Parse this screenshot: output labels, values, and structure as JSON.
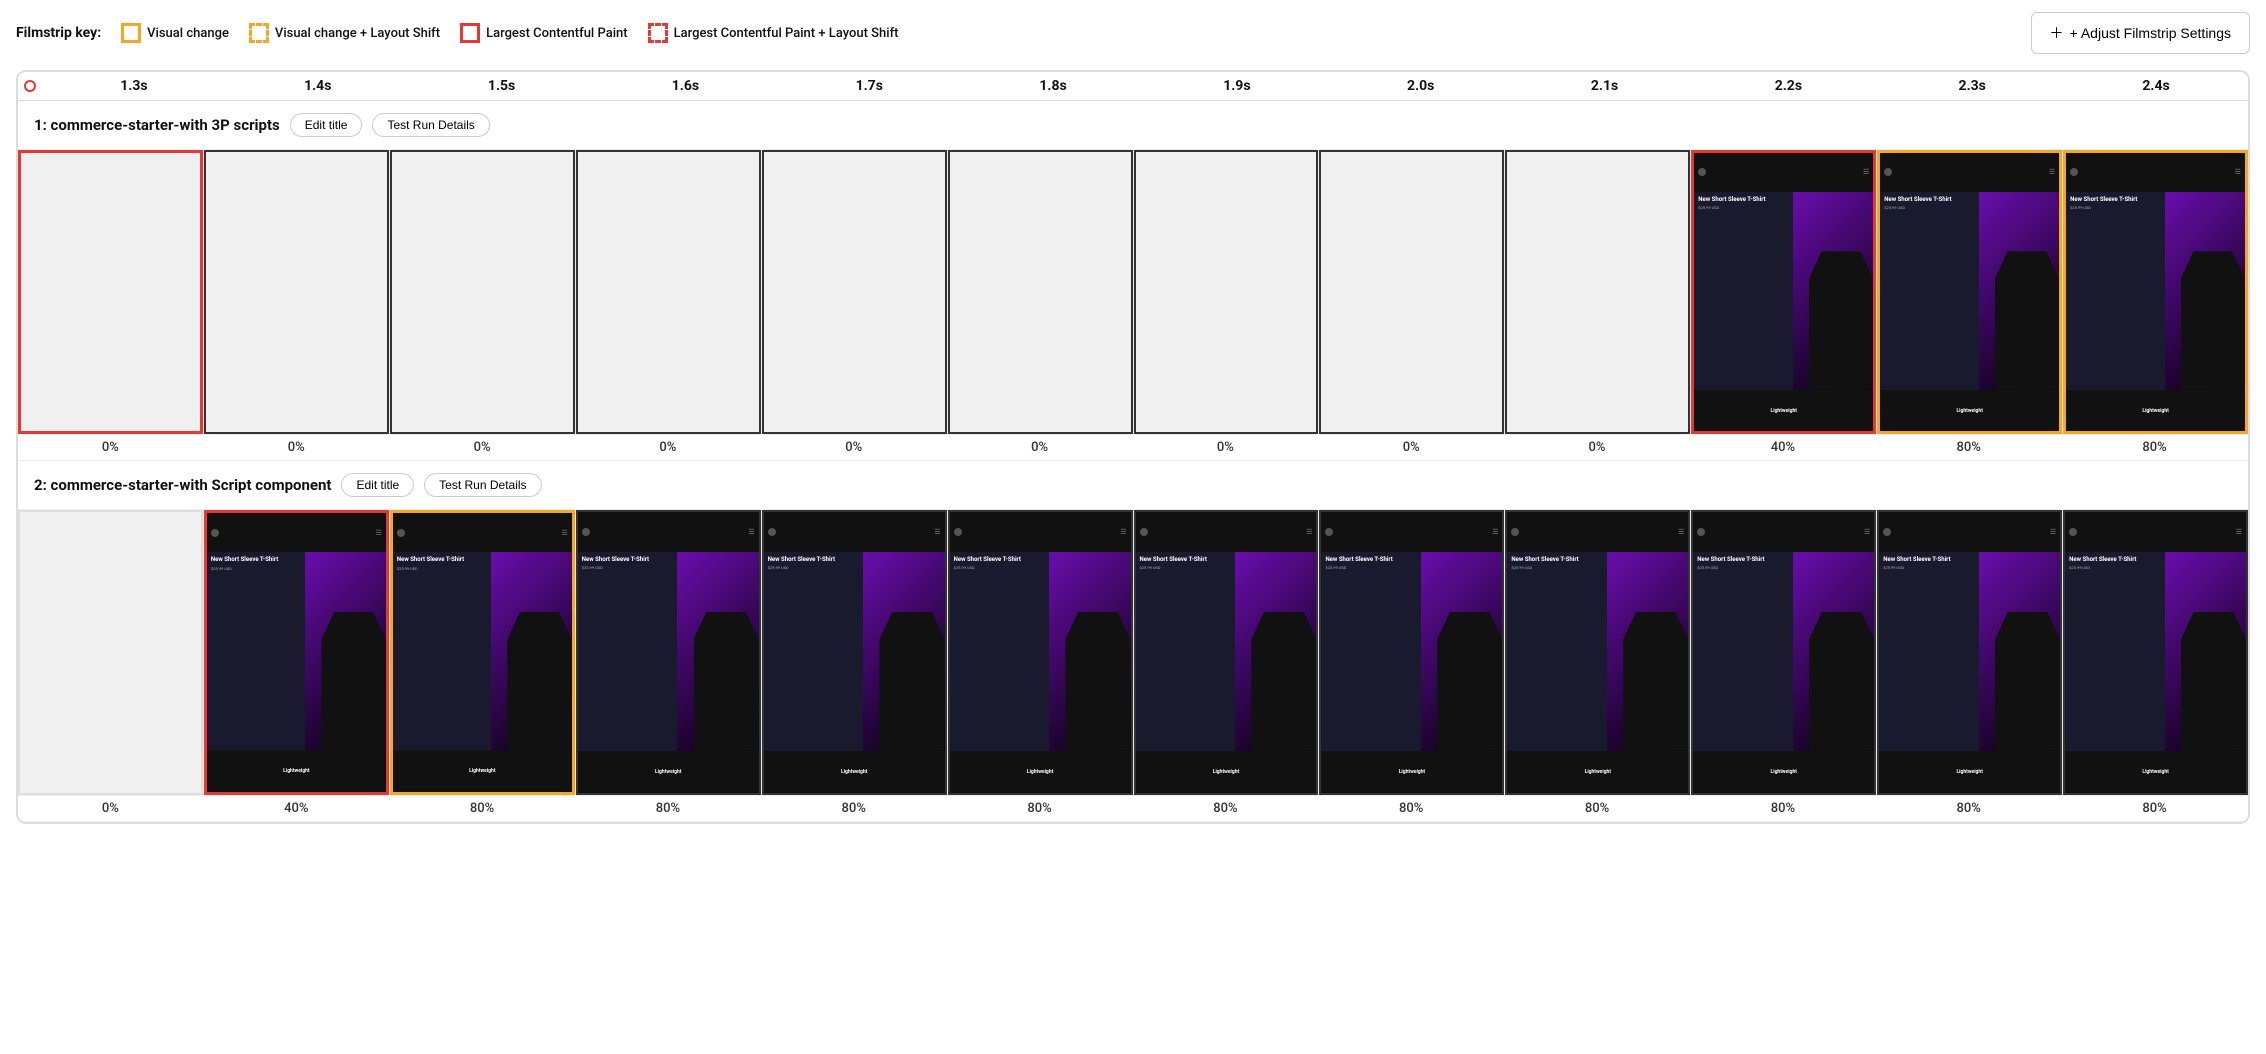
{
  "filmstrip_key": {
    "label": "Filmstrip key:",
    "items": [
      {
        "id": "visual-change",
        "box_type": "yellow-solid",
        "text": "Visual change"
      },
      {
        "id": "visual-change-layout-shift",
        "box_type": "yellow-dashed",
        "text": "Visual change + Layout Shift"
      },
      {
        "id": "largest-contentful-paint",
        "box_type": "red-solid",
        "text": "Largest Contentful Paint"
      },
      {
        "id": "largest-contentful-paint-layout-shift",
        "box_type": "red-dashed",
        "text": "Largest Contentful Paint + Layout Shift"
      }
    ],
    "adjust_button": "+ Adjust Filmstrip Settings"
  },
  "timeline": {
    "times": [
      "1.3s",
      "1.4s",
      "1.5s",
      "1.6s",
      "1.7s",
      "1.8s",
      "1.9s",
      "2.0s",
      "2.1s",
      "2.2s",
      "2.3s",
      "2.4s"
    ]
  },
  "section1": {
    "title": "1: commerce-starter-with 3P scripts",
    "edit_title": "Edit title",
    "test_run": "Test Run Details",
    "frames": [
      {
        "border": "red",
        "pct": "0%",
        "has_content": false
      },
      {
        "border": "plain",
        "pct": "0%",
        "has_content": false
      },
      {
        "border": "plain",
        "pct": "0%",
        "has_content": false
      },
      {
        "border": "plain",
        "pct": "0%",
        "has_content": false
      },
      {
        "border": "plain",
        "pct": "0%",
        "has_content": false
      },
      {
        "border": "plain",
        "pct": "0%",
        "has_content": false
      },
      {
        "border": "plain",
        "pct": "0%",
        "has_content": false
      },
      {
        "border": "plain",
        "pct": "0%",
        "has_content": false
      },
      {
        "border": "plain",
        "pct": "0%",
        "has_content": false
      },
      {
        "border": "red",
        "pct": "40%",
        "has_content": true
      },
      {
        "border": "yellow",
        "pct": "80%",
        "has_content": true
      },
      {
        "border": "yellow",
        "pct": "80%",
        "has_content": true
      }
    ]
  },
  "section2": {
    "title": "2: commerce-starter-with Script component",
    "edit_title": "Edit title",
    "test_run": "Test Run Details",
    "frames": [
      {
        "border": "none",
        "pct": "0%",
        "has_content": false
      },
      {
        "border": "red",
        "pct": "40%",
        "has_content": true
      },
      {
        "border": "yellow",
        "pct": "80%",
        "has_content": true
      },
      {
        "border": "plain",
        "pct": "80%",
        "has_content": true
      },
      {
        "border": "plain",
        "pct": "80%",
        "has_content": true
      },
      {
        "border": "plain",
        "pct": "80%",
        "has_content": true
      },
      {
        "border": "plain",
        "pct": "80%",
        "has_content": true
      },
      {
        "border": "plain",
        "pct": "80%",
        "has_content": true
      },
      {
        "border": "plain",
        "pct": "80%",
        "has_content": true
      },
      {
        "border": "plain",
        "pct": "80%",
        "has_content": true
      },
      {
        "border": "plain",
        "pct": "80%",
        "has_content": true
      },
      {
        "border": "plain",
        "pct": "80%",
        "has_content": true
      }
    ]
  },
  "product": {
    "title": "New Short Sleeve T-Shirt",
    "price": "$25.99 USD",
    "label": "Lightweight"
  }
}
